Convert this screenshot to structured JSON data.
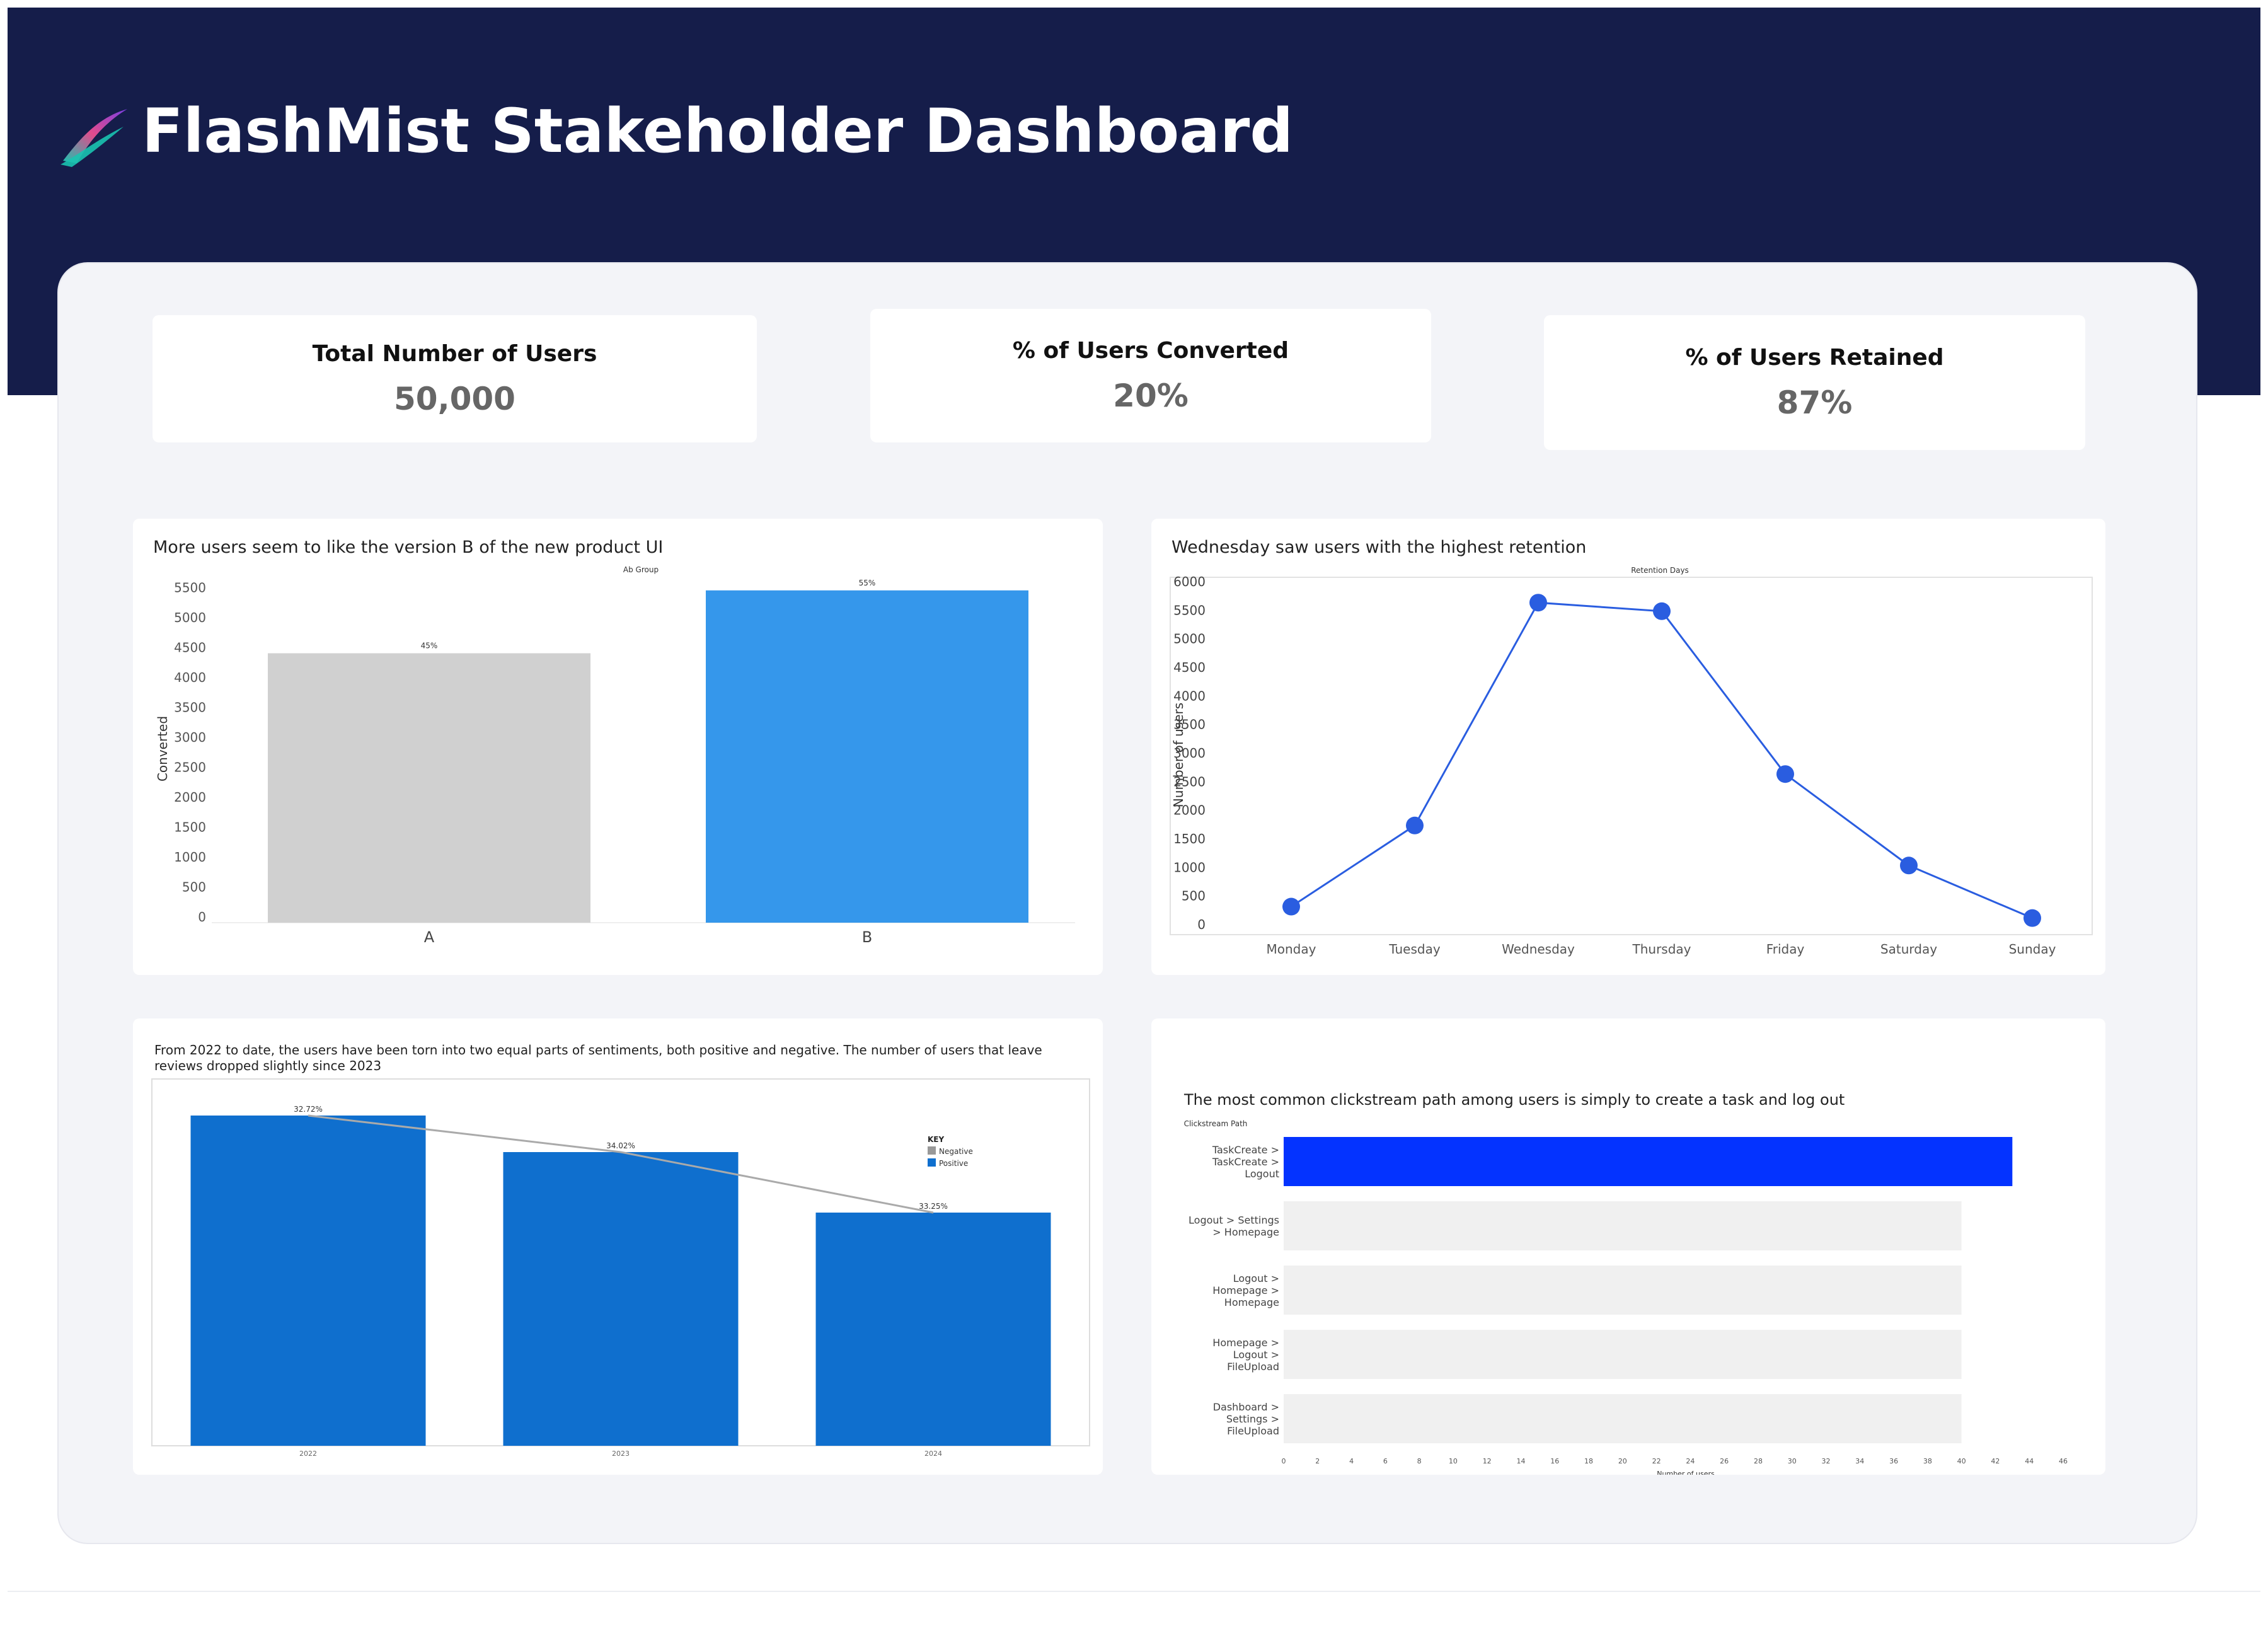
{
  "header": {
    "title": "FlashMist Stakeholder Dashboard",
    "logo_icon": "flashmist-swoosh-icon",
    "bg_color": "#151d4a"
  },
  "kpis": [
    {
      "label": "Total Number of Users",
      "value": "50,000"
    },
    {
      "label": "% of Users Converted",
      "value": "20%"
    },
    {
      "label": "% of Users Retained",
      "value": "87%"
    }
  ],
  "charts": {
    "ab": {
      "title": "More users seem to like the version B of the new product UI",
      "header_label": "Ab Group",
      "ylabel": "Converted"
    },
    "retention": {
      "title": "Wednesday saw users with the highest retention",
      "header_label": "Retention Days",
      "ylabel": "Number of users"
    },
    "sentiment": {
      "title": "From 2022 to date, the users have been torn into two equal parts of sentiments, both positive and negative. The number of users that leave reviews dropped slightly since 2023",
      "legend_title": "KEY",
      "legend_negative": "Negative",
      "legend_positive": "Positive"
    },
    "clickstream": {
      "title": "The most common clickstream path among users is simply to create a task and log out",
      "header_label": "Clickstream Path",
      "xlabel": "Number of users"
    }
  },
  "chart_data": [
    {
      "type": "bar",
      "categories": [
        "A",
        "B"
      ],
      "values": [
        4500,
        5550
      ],
      "data_labels": [
        "45%",
        "55%"
      ],
      "colors": [
        "#d0d0d0",
        "#3597eb"
      ],
      "title": "More users seem to like the version B of the new product UI",
      "xlabel": "Ab Group",
      "ylabel": "Converted",
      "ylim": [
        0,
        5800
      ],
      "yticks": [
        0,
        500,
        1000,
        1500,
        2000,
        2500,
        3000,
        3500,
        4000,
        4500,
        5000,
        5500
      ],
      "grid": false
    },
    {
      "type": "line",
      "x": [
        "Monday",
        "Tuesday",
        "Wednesday",
        "Thursday",
        "Friday",
        "Saturday",
        "Sunday"
      ],
      "values": [
        380,
        1800,
        5700,
        5550,
        2700,
        1100,
        180
      ],
      "color": "#2a5de0",
      "title": "Wednesday saw users with the highest retention",
      "xlabel": "Retention Days",
      "ylabel": "Number of users",
      "ylim": [
        0,
        6000
      ],
      "yticks": [
        0,
        500,
        1000,
        1500,
        2000,
        2500,
        3000,
        3500,
        4000,
        4500,
        5000,
        5500,
        6000
      ],
      "grid": false
    },
    {
      "type": "bar",
      "categories": [
        "2022",
        "2023",
        "2024"
      ],
      "values": [
        32.72,
        34.02,
        33.25
      ],
      "data_labels": [
        "32.72%",
        "34.02%",
        "33.25%"
      ],
      "bar_color": "#0f6fce",
      "trend_color": "#aaaaaa",
      "legend": [
        {
          "name": "Negative",
          "color": "#999999"
        },
        {
          "name": "Positive",
          "color": "#0f6fce"
        }
      ],
      "legend_title": "KEY",
      "legend_position": "top-right",
      "title": "From 2022 to date, the users have been torn into two equal parts of sentiments, both positive and negative. The number of users that leave reviews dropped slightly since 2023"
    },
    {
      "type": "bar",
      "orientation": "horizontal",
      "categories": [
        [
          "TaskCreate >",
          "TaskCreate >",
          "Logout"
        ],
        [
          "Logout > Settings",
          "> Homepage"
        ],
        [
          "Logout >",
          "Homepage >",
          "Homepage"
        ],
        [
          "Homepage >",
          "Logout >",
          "FileUpload"
        ],
        [
          "Dashboard >",
          "Settings >",
          "FileUpload"
        ]
      ],
      "values": [
        43,
        40,
        40,
        40,
        40
      ],
      "colors": [
        "#0433ff",
        "#f0f0f0",
        "#f0f0f0",
        "#f0f0f0",
        "#f0f0f0"
      ],
      "title": "The most common clickstream path among users is simply to create a task and log out",
      "ylabel": "Clickstream Path",
      "xlabel": "Number of users",
      "xlim": [
        0,
        46
      ],
      "xticks": [
        0,
        2,
        4,
        6,
        8,
        10,
        12,
        14,
        16,
        18,
        20,
        22,
        24,
        26,
        28,
        30,
        32,
        34,
        36,
        38,
        40,
        42,
        44,
        46
      ],
      "grid": false
    }
  ]
}
